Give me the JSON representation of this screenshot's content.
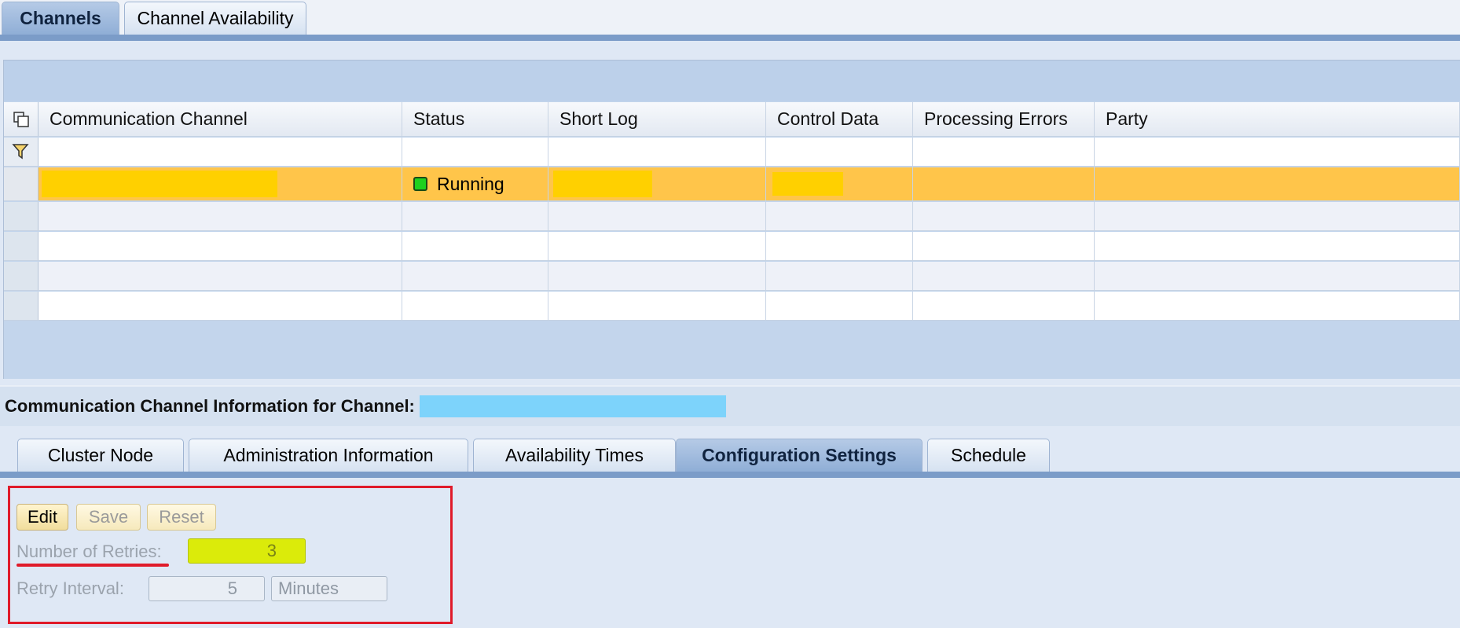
{
  "top_tabs": [
    {
      "label": "Channels",
      "active": true
    },
    {
      "label": "Channel Availability",
      "active": false
    }
  ],
  "table": {
    "columns": [
      "Communication Channel",
      "Status",
      "Short Log",
      "Control Data",
      "Processing Errors",
      "Party"
    ],
    "selected_row": {
      "communication_channel": "",
      "status": "Running",
      "status_color": "#1ed11e",
      "short_log": "",
      "control_data": "",
      "processing_errors": "",
      "party": ""
    },
    "selected_row_color": "#ffc54a"
  },
  "info_bar": {
    "label": "Communication Channel Information for Channel:",
    "channel_name": ""
  },
  "detail_tabs": [
    {
      "label": "Cluster Node",
      "active": false
    },
    {
      "label": "Administration Information",
      "active": false
    },
    {
      "label": "Availability Times",
      "active": false
    },
    {
      "label": "Configuration Settings",
      "active": true
    },
    {
      "label": "Schedule",
      "active": false
    }
  ],
  "config": {
    "edit_label": "Edit",
    "save_label": "Save",
    "reset_label": "Reset",
    "retries_label": "Number of Retries:",
    "retries_value": "3",
    "interval_label": "Retry Interval:",
    "interval_value": "5",
    "interval_unit": "Minutes"
  },
  "colors": {
    "tab_strip": "#7b9cc8",
    "annotation_red": "#e01b2a",
    "highlight_yellow": "#dbeb0a",
    "redaction_yellow": "#ffd000",
    "redaction_blue": "#7dd3fb"
  }
}
